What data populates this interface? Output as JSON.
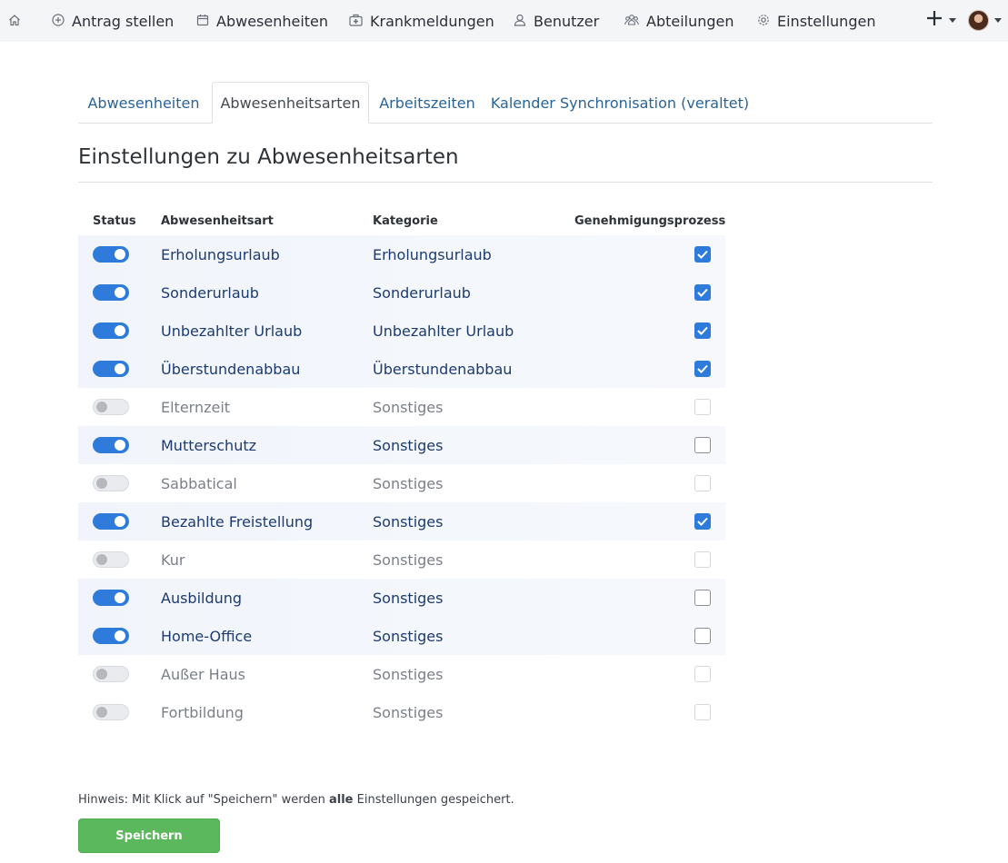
{
  "nav": {
    "items": [
      {
        "label": "Antrag stellen",
        "icon": "plus-circle-icon"
      },
      {
        "label": "Abwesenheiten",
        "icon": "calendar-icon"
      },
      {
        "label": "Krankmeldungen",
        "icon": "medical-bag-icon"
      },
      {
        "label": "Benutzer",
        "icon": "user-icon"
      },
      {
        "label": "Abteilungen",
        "icon": "users-group-icon"
      },
      {
        "label": "Einstellungen",
        "icon": "gear-icon"
      }
    ]
  },
  "tabs": [
    {
      "label": "Abwesenheiten",
      "active": false
    },
    {
      "label": "Abwesenheitsarten",
      "active": true
    },
    {
      "label": "Arbeitszeiten",
      "active": false
    },
    {
      "label": "Kalender Synchronisation (veraltet)",
      "active": false
    }
  ],
  "page": {
    "title": "Einstellungen zu Abwesenheitsarten"
  },
  "table": {
    "headers": {
      "status": "Status",
      "type": "Abwesenheitsart",
      "category": "Kategorie",
      "approval": "Genehmigungsprozess"
    },
    "rows": [
      {
        "enabled": true,
        "type": "Erholungsurlaub",
        "category": "Erholungsurlaub",
        "approval": true
      },
      {
        "enabled": true,
        "type": "Sonderurlaub",
        "category": "Sonderurlaub",
        "approval": true
      },
      {
        "enabled": true,
        "type": "Unbezahlter Urlaub",
        "category": "Unbezahlter Urlaub",
        "approval": true
      },
      {
        "enabled": true,
        "type": "Überstundenabbau",
        "category": "Überstundenabbau",
        "approval": true
      },
      {
        "enabled": false,
        "type": "Elternzeit",
        "category": "Sonstiges",
        "approval": false
      },
      {
        "enabled": true,
        "type": "Mutterschutz",
        "category": "Sonstiges",
        "approval": false
      },
      {
        "enabled": false,
        "type": "Sabbatical",
        "category": "Sonstiges",
        "approval": false
      },
      {
        "enabled": true,
        "type": "Bezahlte Freistellung",
        "category": "Sonstiges",
        "approval": true
      },
      {
        "enabled": false,
        "type": "Kur",
        "category": "Sonstiges",
        "approval": false
      },
      {
        "enabled": true,
        "type": "Ausbildung",
        "category": "Sonstiges",
        "approval": false
      },
      {
        "enabled": true,
        "type": "Home-Office",
        "category": "Sonstiges",
        "approval": false
      },
      {
        "enabled": false,
        "type": "Außer Haus",
        "category": "Sonstiges",
        "approval": false
      },
      {
        "enabled": false,
        "type": "Fortbildung",
        "category": "Sonstiges",
        "approval": false
      }
    ]
  },
  "footer": {
    "hint_prefix": "Hinweis: Mit Klick auf \"Speichern\" werden ",
    "hint_bold": "alle",
    "hint_suffix": " Einstellungen gespeichert.",
    "save_label": "Speichern"
  },
  "colors": {
    "accent": "#2f7bdc",
    "save": "#5cb85c",
    "link": "#2a6496"
  }
}
